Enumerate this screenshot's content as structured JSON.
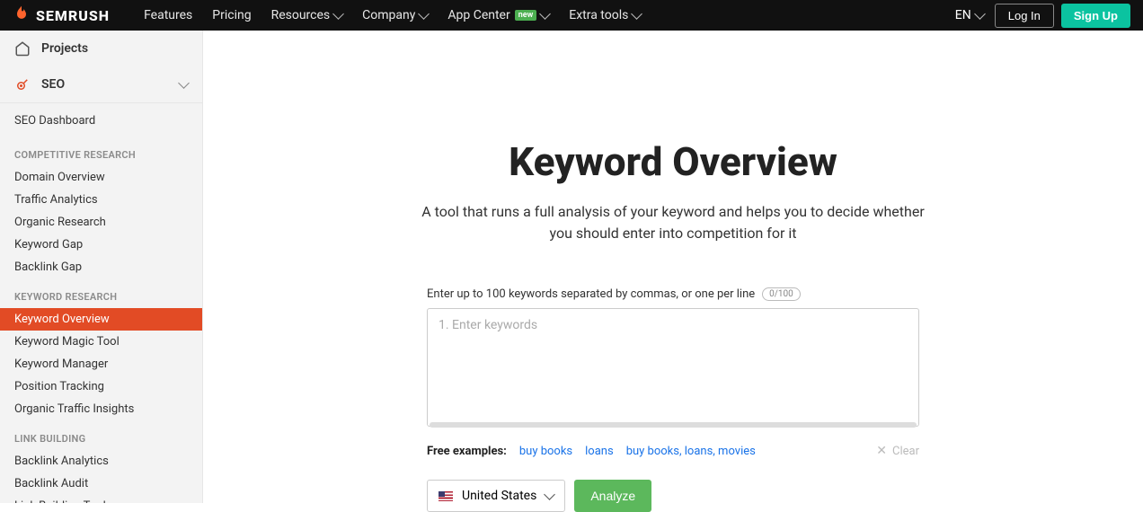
{
  "header": {
    "brand": "SEMRUSH",
    "nav": [
      "Features",
      "Pricing",
      "Resources",
      "Company",
      "App Center",
      "Extra tools"
    ],
    "new_badge": "new",
    "lang": "EN",
    "login": "Log In",
    "signup": "Sign Up"
  },
  "sidebar": {
    "projects": "Projects",
    "seo": "SEO",
    "seo_dash": "SEO Dashboard",
    "groups": [
      {
        "label": "COMPETITIVE RESEARCH",
        "items": [
          "Domain Overview",
          "Traffic Analytics",
          "Organic Research",
          "Keyword Gap",
          "Backlink Gap"
        ]
      },
      {
        "label": "KEYWORD RESEARCH",
        "items": [
          "Keyword Overview",
          "Keyword Magic Tool",
          "Keyword Manager",
          "Position Tracking",
          "Organic Traffic Insights"
        ]
      },
      {
        "label": "LINK BUILDING",
        "items": [
          "Backlink Analytics",
          "Backlink Audit",
          "Link Building Tool"
        ]
      }
    ],
    "active": "Keyword Overview"
  },
  "main": {
    "title": "Keyword Overview",
    "subtitle": "A tool that runs a full analysis of your keyword and helps you to decide whether you should enter into competition for it",
    "hint": "Enter up to 100 keywords separated by commas, or one per line",
    "counter": "0/100",
    "placeholder": "1. Enter keywords",
    "examples_label": "Free examples:",
    "examples": [
      "buy books",
      "loans",
      "buy books, loans, movies"
    ],
    "clear": "Clear",
    "database": "United States",
    "analyze": "Analyze"
  }
}
